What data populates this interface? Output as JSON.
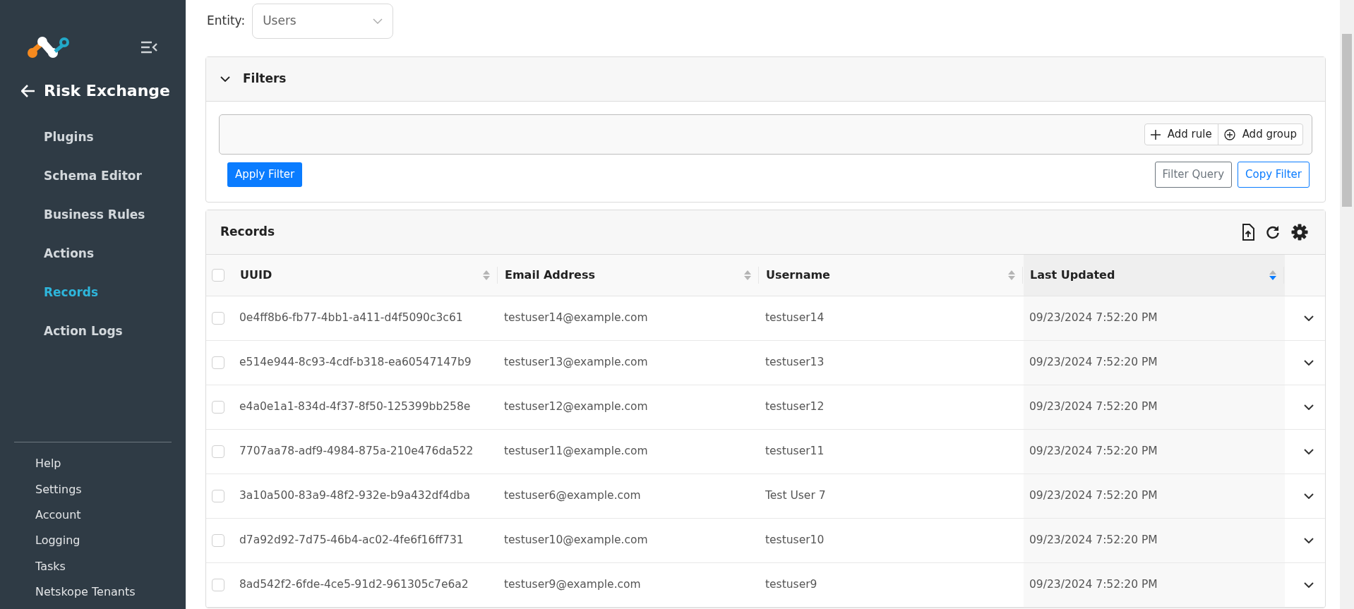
{
  "sidebar": {
    "title": "Risk Exchange",
    "nav": [
      {
        "label": "Plugins",
        "selected": false
      },
      {
        "label": "Schema Editor",
        "selected": false
      },
      {
        "label": "Business Rules",
        "selected": false
      },
      {
        "label": "Actions",
        "selected": false
      },
      {
        "label": "Records",
        "selected": true
      },
      {
        "label": "Action Logs",
        "selected": false
      }
    ],
    "footer": [
      "Help",
      "Settings",
      "Account",
      "Logging",
      "Tasks",
      "Netskope Tenants"
    ]
  },
  "entity": {
    "label": "Entity:",
    "value": "Users"
  },
  "filters": {
    "title": "Filters",
    "expanded": true,
    "add_rule": "Add rule",
    "add_group": "Add group",
    "apply": "Apply Filter",
    "filter_query": "Filter Query",
    "copy_filter": "Copy Filter"
  },
  "records": {
    "title": "Records",
    "header_checked": false,
    "columns": [
      {
        "label": "UUID",
        "sorted": false
      },
      {
        "label": "Email Address",
        "sorted": false
      },
      {
        "label": "Username",
        "sorted": false
      },
      {
        "label": "Last Updated",
        "sorted": true
      }
    ],
    "rows": [
      {
        "checked": false,
        "cells": [
          "0e4ff8b6-fb77-4bb1-a411-d4f5090c3c61",
          "testuser14@example.com",
          "testuser14",
          "09/23/2024 7:52:20 PM"
        ]
      },
      {
        "checked": false,
        "cells": [
          "e514e944-8c93-4cdf-b318-ea60547147b9",
          "testuser13@example.com",
          "testuser13",
          "09/23/2024 7:52:20 PM"
        ]
      },
      {
        "checked": false,
        "cells": [
          "e4a0e1a1-834d-4f37-8f50-125399bb258e",
          "testuser12@example.com",
          "testuser12",
          "09/23/2024 7:52:20 PM"
        ]
      },
      {
        "checked": false,
        "cells": [
          "7707aa78-adf9-4984-875a-210e476da522",
          "testuser11@example.com",
          "testuser11",
          "09/23/2024 7:52:20 PM"
        ]
      },
      {
        "checked": false,
        "cells": [
          "3a10a500-83a9-48f2-932e-b9a432df4dba",
          "testuser6@example.com",
          "Test User 7",
          "09/23/2024 7:52:20 PM"
        ]
      },
      {
        "checked": false,
        "cells": [
          "d7a92d92-7d75-46b4-ac02-4fe6f16ff731",
          "testuser10@example.com",
          "testuser10",
          "09/23/2024 7:52:20 PM"
        ]
      },
      {
        "checked": false,
        "cells": [
          "8ad542f2-6fde-4ce5-91d2-961305c7e6a2",
          "testuser9@example.com",
          "testuser9",
          "09/23/2024 7:52:20 PM"
        ]
      }
    ]
  }
}
